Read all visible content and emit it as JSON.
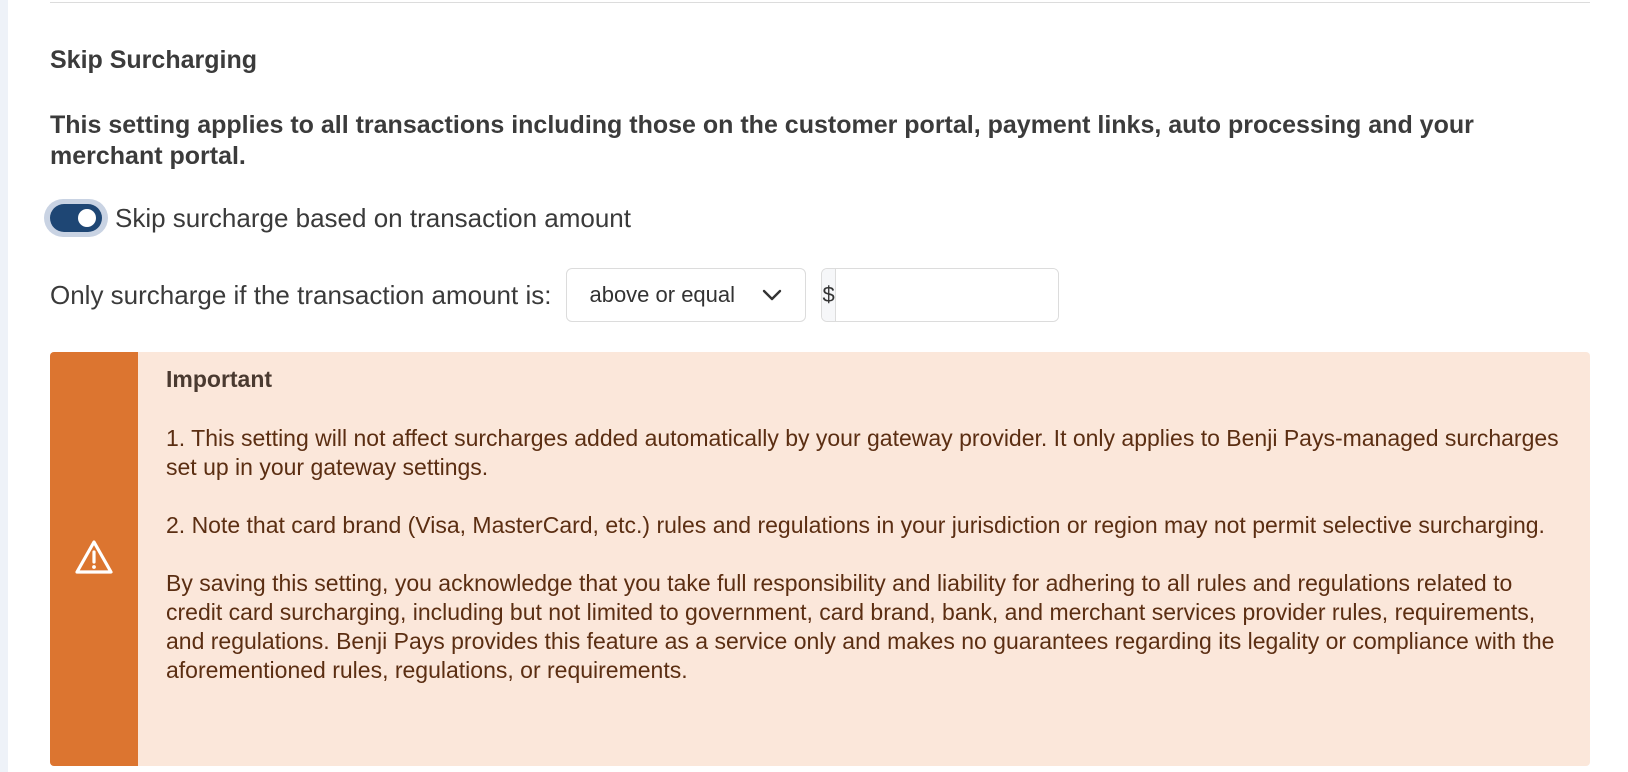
{
  "section": {
    "title": "Skip Surcharging",
    "notice": "This setting applies to all transactions including those on the customer portal, payment links, auto processing and your merchant portal."
  },
  "toggle": {
    "label": "Skip surcharge based on transaction amount",
    "state": "on"
  },
  "amount_rule": {
    "label": "Only surcharge if the transaction amount is:",
    "comparison_selected": "above or equal",
    "currency_symbol": "$",
    "amount_value": ""
  },
  "alert": {
    "title": "Important",
    "paragraphs": [
      "1. This setting will not affect surcharges added automatically by your gateway provider. It only applies to Benji Pays-managed surcharges set up in your gateway settings.",
      "2. Note that card brand (Visa, MasterCard, etc.) rules and regulations in your jurisdiction or region may not permit selective surcharging.",
      "By saving this setting, you acknowledge that you take full responsibility and liability for adhering to all rules and regulations related to credit card surcharging, including but not limited to government, card brand, bank, and merchant services provider rules, requirements, and regulations. Benji Pays provides this feature as a service only and makes no guarantees regarding its legality or compliance with the aforementioned rules, regulations, or requirements."
    ],
    "icon": "warning-icon"
  },
  "colors": {
    "toggle_on": "#1e4674",
    "alert_accent": "#dc7530",
    "alert_background": "#fbe7da",
    "alert_text": "#5b2e12"
  }
}
